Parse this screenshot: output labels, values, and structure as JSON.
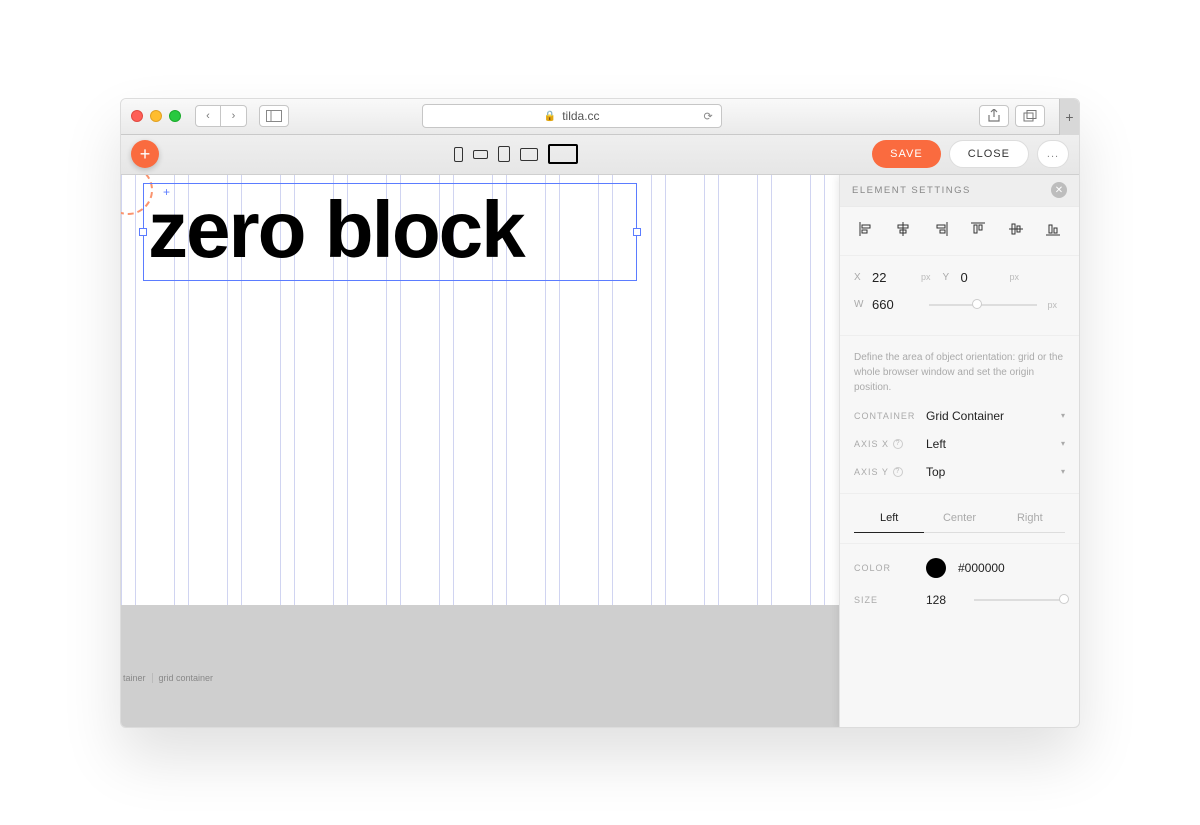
{
  "browser": {
    "url": "tilda.cc"
  },
  "toolbar": {
    "save": "SAVE",
    "close": "CLOSE",
    "more": "..."
  },
  "canvas": {
    "selected_text": "zero block"
  },
  "footer": {
    "label1": "tainer",
    "label2": "grid container"
  },
  "panel": {
    "title": "ELEMENT SETTINGS",
    "position": {
      "x_label": "X",
      "x_value": "22",
      "y_label": "Y",
      "y_value": "0",
      "w_label": "W",
      "w_value": "660",
      "unit": "px"
    },
    "orientation": {
      "description": "Define the area of object orientation: grid or the whole browser window and set the origin position.",
      "container_label": "CONTAINER",
      "container_value": "Grid Container",
      "axis_x_label": "AXIS X",
      "axis_x_value": "Left",
      "axis_y_label": "AXIS Y",
      "axis_y_value": "Top"
    },
    "text_align": {
      "left": "Left",
      "center": "Center",
      "right": "Right"
    },
    "color": {
      "label": "COLOR",
      "value": "#000000"
    },
    "size": {
      "label": "SIZE",
      "value": "128"
    }
  }
}
